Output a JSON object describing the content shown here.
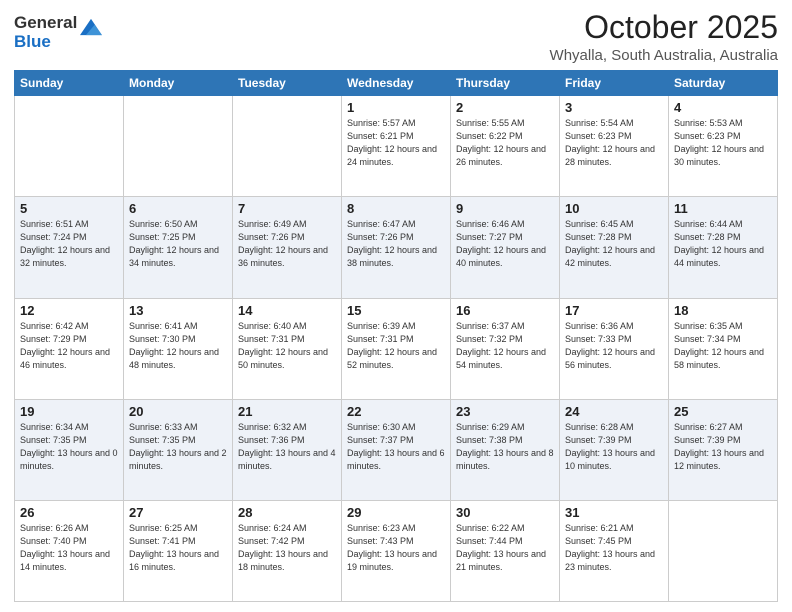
{
  "logo": {
    "general": "General",
    "blue": "Blue"
  },
  "header": {
    "month": "October 2025",
    "location": "Whyalla, South Australia, Australia"
  },
  "weekdays": [
    "Sunday",
    "Monday",
    "Tuesday",
    "Wednesday",
    "Thursday",
    "Friday",
    "Saturday"
  ],
  "weeks": [
    [
      {
        "day": "",
        "sunrise": "",
        "sunset": "",
        "daylight": ""
      },
      {
        "day": "",
        "sunrise": "",
        "sunset": "",
        "daylight": ""
      },
      {
        "day": "",
        "sunrise": "",
        "sunset": "",
        "daylight": ""
      },
      {
        "day": "1",
        "sunrise": "Sunrise: 5:57 AM",
        "sunset": "Sunset: 6:21 PM",
        "daylight": "Daylight: 12 hours and 24 minutes."
      },
      {
        "day": "2",
        "sunrise": "Sunrise: 5:55 AM",
        "sunset": "Sunset: 6:22 PM",
        "daylight": "Daylight: 12 hours and 26 minutes."
      },
      {
        "day": "3",
        "sunrise": "Sunrise: 5:54 AM",
        "sunset": "Sunset: 6:23 PM",
        "daylight": "Daylight: 12 hours and 28 minutes."
      },
      {
        "day": "4",
        "sunrise": "Sunrise: 5:53 AM",
        "sunset": "Sunset: 6:23 PM",
        "daylight": "Daylight: 12 hours and 30 minutes."
      }
    ],
    [
      {
        "day": "5",
        "sunrise": "Sunrise: 6:51 AM",
        "sunset": "Sunset: 7:24 PM",
        "daylight": "Daylight: 12 hours and 32 minutes."
      },
      {
        "day": "6",
        "sunrise": "Sunrise: 6:50 AM",
        "sunset": "Sunset: 7:25 PM",
        "daylight": "Daylight: 12 hours and 34 minutes."
      },
      {
        "day": "7",
        "sunrise": "Sunrise: 6:49 AM",
        "sunset": "Sunset: 7:26 PM",
        "daylight": "Daylight: 12 hours and 36 minutes."
      },
      {
        "day": "8",
        "sunrise": "Sunrise: 6:47 AM",
        "sunset": "Sunset: 7:26 PM",
        "daylight": "Daylight: 12 hours and 38 minutes."
      },
      {
        "day": "9",
        "sunrise": "Sunrise: 6:46 AM",
        "sunset": "Sunset: 7:27 PM",
        "daylight": "Daylight: 12 hours and 40 minutes."
      },
      {
        "day": "10",
        "sunrise": "Sunrise: 6:45 AM",
        "sunset": "Sunset: 7:28 PM",
        "daylight": "Daylight: 12 hours and 42 minutes."
      },
      {
        "day": "11",
        "sunrise": "Sunrise: 6:44 AM",
        "sunset": "Sunset: 7:28 PM",
        "daylight": "Daylight: 12 hours and 44 minutes."
      }
    ],
    [
      {
        "day": "12",
        "sunrise": "Sunrise: 6:42 AM",
        "sunset": "Sunset: 7:29 PM",
        "daylight": "Daylight: 12 hours and 46 minutes."
      },
      {
        "day": "13",
        "sunrise": "Sunrise: 6:41 AM",
        "sunset": "Sunset: 7:30 PM",
        "daylight": "Daylight: 12 hours and 48 minutes."
      },
      {
        "day": "14",
        "sunrise": "Sunrise: 6:40 AM",
        "sunset": "Sunset: 7:31 PM",
        "daylight": "Daylight: 12 hours and 50 minutes."
      },
      {
        "day": "15",
        "sunrise": "Sunrise: 6:39 AM",
        "sunset": "Sunset: 7:31 PM",
        "daylight": "Daylight: 12 hours and 52 minutes."
      },
      {
        "day": "16",
        "sunrise": "Sunrise: 6:37 AM",
        "sunset": "Sunset: 7:32 PM",
        "daylight": "Daylight: 12 hours and 54 minutes."
      },
      {
        "day": "17",
        "sunrise": "Sunrise: 6:36 AM",
        "sunset": "Sunset: 7:33 PM",
        "daylight": "Daylight: 12 hours and 56 minutes."
      },
      {
        "day": "18",
        "sunrise": "Sunrise: 6:35 AM",
        "sunset": "Sunset: 7:34 PM",
        "daylight": "Daylight: 12 hours and 58 minutes."
      }
    ],
    [
      {
        "day": "19",
        "sunrise": "Sunrise: 6:34 AM",
        "sunset": "Sunset: 7:35 PM",
        "daylight": "Daylight: 13 hours and 0 minutes."
      },
      {
        "day": "20",
        "sunrise": "Sunrise: 6:33 AM",
        "sunset": "Sunset: 7:35 PM",
        "daylight": "Daylight: 13 hours and 2 minutes."
      },
      {
        "day": "21",
        "sunrise": "Sunrise: 6:32 AM",
        "sunset": "Sunset: 7:36 PM",
        "daylight": "Daylight: 13 hours and 4 minutes."
      },
      {
        "day": "22",
        "sunrise": "Sunrise: 6:30 AM",
        "sunset": "Sunset: 7:37 PM",
        "daylight": "Daylight: 13 hours and 6 minutes."
      },
      {
        "day": "23",
        "sunrise": "Sunrise: 6:29 AM",
        "sunset": "Sunset: 7:38 PM",
        "daylight": "Daylight: 13 hours and 8 minutes."
      },
      {
        "day": "24",
        "sunrise": "Sunrise: 6:28 AM",
        "sunset": "Sunset: 7:39 PM",
        "daylight": "Daylight: 13 hours and 10 minutes."
      },
      {
        "day": "25",
        "sunrise": "Sunrise: 6:27 AM",
        "sunset": "Sunset: 7:39 PM",
        "daylight": "Daylight: 13 hours and 12 minutes."
      }
    ],
    [
      {
        "day": "26",
        "sunrise": "Sunrise: 6:26 AM",
        "sunset": "Sunset: 7:40 PM",
        "daylight": "Daylight: 13 hours and 14 minutes."
      },
      {
        "day": "27",
        "sunrise": "Sunrise: 6:25 AM",
        "sunset": "Sunset: 7:41 PM",
        "daylight": "Daylight: 13 hours and 16 minutes."
      },
      {
        "day": "28",
        "sunrise": "Sunrise: 6:24 AM",
        "sunset": "Sunset: 7:42 PM",
        "daylight": "Daylight: 13 hours and 18 minutes."
      },
      {
        "day": "29",
        "sunrise": "Sunrise: 6:23 AM",
        "sunset": "Sunset: 7:43 PM",
        "daylight": "Daylight: 13 hours and 19 minutes."
      },
      {
        "day": "30",
        "sunrise": "Sunrise: 6:22 AM",
        "sunset": "Sunset: 7:44 PM",
        "daylight": "Daylight: 13 hours and 21 minutes."
      },
      {
        "day": "31",
        "sunrise": "Sunrise: 6:21 AM",
        "sunset": "Sunset: 7:45 PM",
        "daylight": "Daylight: 13 hours and 23 minutes."
      },
      {
        "day": "",
        "sunrise": "",
        "sunset": "",
        "daylight": ""
      }
    ]
  ]
}
